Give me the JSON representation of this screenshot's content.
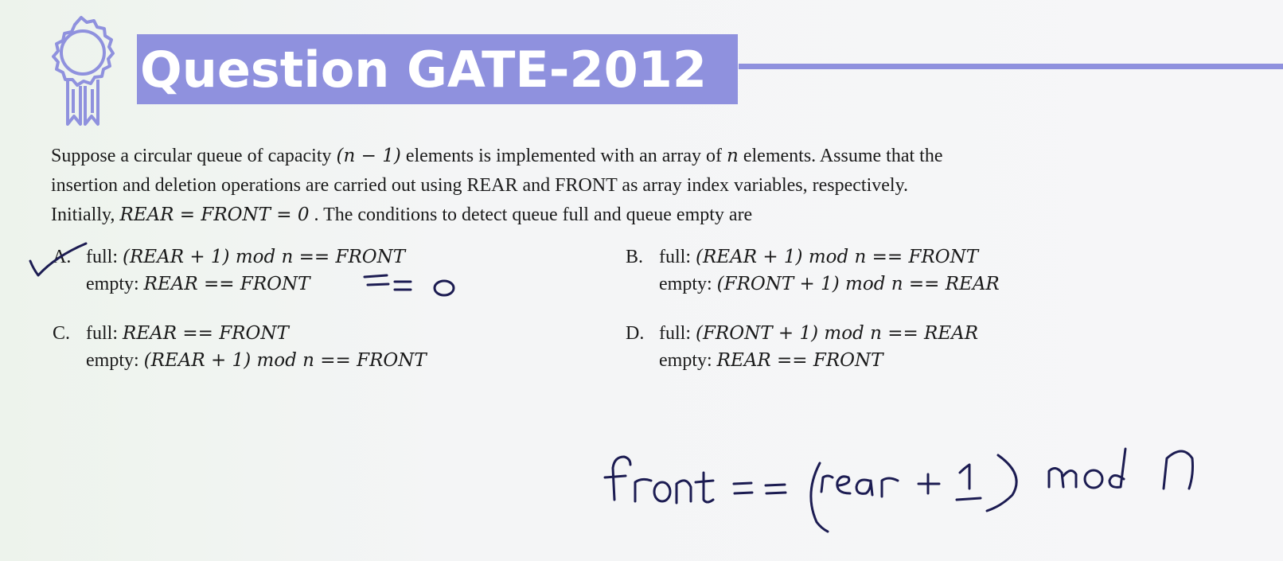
{
  "header": {
    "title": "Question GATE-2012"
  },
  "question": {
    "line1_pre": "Suppose a circular queue of capacity ",
    "line1_math": "(n − 1)",
    "line1_mid": " elements is implemented with an array of ",
    "line1_n": "n",
    "line1_post": " elements. Assume that the",
    "line2": "insertion and deletion operations are carried out using REAR and FRONT as array index variables, respectively.",
    "line3_pre": "Initially, ",
    "line3_math": "REAR = FRONT = 0",
    "line3_post": " . The conditions to detect queue full and queue empty are"
  },
  "options": [
    {
      "letter": "A.",
      "full_label": "full: ",
      "full": "(REAR + 1)  mod n == FRONT",
      "empty_label": "empty: ",
      "empty": "REAR == FRONT"
    },
    {
      "letter": "B.",
      "full_label": "full: ",
      "full": "(REAR + 1)  mod n == FRONT",
      "empty_label": "empty: ",
      "empty": "(FRONT + 1)  mod n == REAR"
    },
    {
      "letter": "C.",
      "full_label": "full: ",
      "full": "REAR == FRONT",
      "empty_label": "empty: ",
      "empty": "(REAR + 1)  mod n == FRONT"
    },
    {
      "letter": "D.",
      "full_label": "full: ",
      "full": "(FRONT + 1)  mod n == REAR",
      "empty_label": "empty: ",
      "empty": "REAR == FRONT"
    }
  ],
  "annotations": {
    "handwritten_note": "front = = (rear + 1) mod n",
    "option_a_extra": "= = 0",
    "ink_color": "#1c1c52"
  },
  "colors": {
    "accent": "#8f91de",
    "title_text": "#ffffff"
  }
}
